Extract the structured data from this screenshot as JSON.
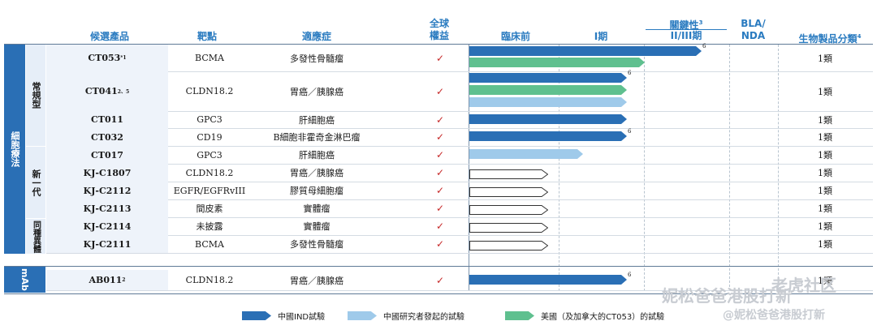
{
  "header": {
    "candidate": "候選產品",
    "target": "靶點",
    "indication": "適應症",
    "rights_line1": "全球",
    "rights_line2": "權益",
    "preclinical": "臨床前",
    "phase1": "I期",
    "pivotal_line1": "關鍵性",
    "pivotal_sup": "3",
    "pivotal_line2": "II/III期",
    "bla_line1": "BLA/",
    "bla_line2": "NDA",
    "category": "生物製品分類",
    "category_sup": "4"
  },
  "groups": {
    "cell_therapy": "細胞療法",
    "conventional": "常規型",
    "next_gen": "新一代",
    "allogeneic": "同種異體",
    "mab": "mAb"
  },
  "rows": [
    {
      "candidate": "CT053",
      "sup": "*1",
      "target": "BCMA",
      "indication": "多發性骨髓瘤",
      "check": "✓",
      "category": "1類",
      "bar_sup": "6"
    },
    {
      "candidate": "CT041",
      "sup": "2、5",
      "target": "CLDN18.2",
      "indication": "胃癌／胰腺癌",
      "check": "✓",
      "category": "1類",
      "bar_sup": "6"
    },
    {
      "candidate": "CT011",
      "sup": "",
      "target": "GPC3",
      "indication": "肝細胞癌",
      "check": "✓",
      "category": "1類",
      "bar_sup": ""
    },
    {
      "candidate": "CT032",
      "sup": "",
      "target": "CD19",
      "indication": "B細胞非霍奇金淋巴瘤",
      "check": "✓",
      "category": "1類",
      "bar_sup": "6"
    },
    {
      "candidate": "CT017",
      "sup": "",
      "target": "GPC3",
      "indication": "肝細胞癌",
      "check": "✓",
      "category": "1類",
      "bar_sup": ""
    },
    {
      "candidate": "KJ-C1807",
      "sup": "",
      "target": "CLDN18.2",
      "indication": "胃癌／胰腺癌",
      "check": "✓",
      "category": "1類",
      "bar_sup": ""
    },
    {
      "candidate": "KJ-C2112",
      "sup": "",
      "target": "EGFR/EGFRvIII",
      "indication": "膠質母細胞瘤",
      "check": "✓",
      "category": "1類",
      "bar_sup": ""
    },
    {
      "candidate": "KJ-C2113",
      "sup": "",
      "target": "間皮素",
      "indication": "實體瘤",
      "check": "✓",
      "category": "1類",
      "bar_sup": ""
    },
    {
      "candidate": "KJ-C2114",
      "sup": "",
      "target": "未披露",
      "indication": "實體瘤",
      "check": "✓",
      "category": "1類",
      "bar_sup": ""
    },
    {
      "candidate": "KJ-C2111",
      "sup": "",
      "target": "BCMA",
      "indication": "多發性骨髓瘤",
      "check": "✓",
      "category": "1類",
      "bar_sup": ""
    },
    {
      "candidate": "AB011",
      "sup": "2",
      "target": "CLDN18.2",
      "indication": "胃癌／胰腺癌",
      "check": "✓",
      "category": "1類",
      "bar_sup": "6"
    }
  ],
  "legend": [
    {
      "label": "中國IND試驗",
      "color": "#2a6fb5"
    },
    {
      "label": "中國研究者發起的試驗",
      "color": "#9fcaea"
    },
    {
      "label": "美國（及加拿大的CT053）的試驗",
      "color": "#5fc08f"
    }
  ],
  "colors": {
    "china_ind": "#2a6fb5",
    "china_iit": "#9fcaea",
    "us_trial": "#5fc08f",
    "header_blue": "#2a7bc0"
  },
  "watermark": {
    "line1": "老虎社区",
    "line2": "妮松爸爸港股打新",
    "line3": "@妮松爸爸港股打新"
  }
}
